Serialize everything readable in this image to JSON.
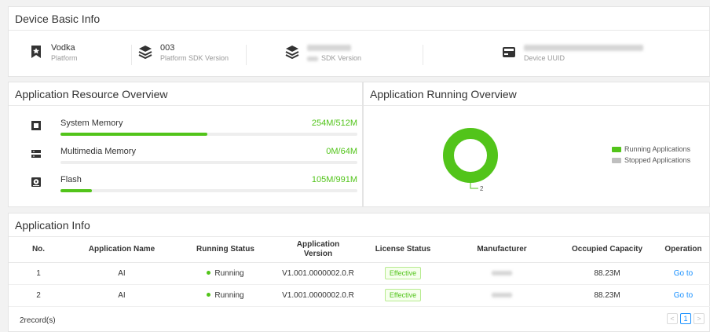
{
  "basic_info": {
    "title": "Device Basic Info",
    "items": [
      {
        "value": "Vodka",
        "label": "Platform",
        "icon": "bookmark-star-icon"
      },
      {
        "value": "003",
        "label": "Platform SDK Version",
        "icon": "layers-icon"
      },
      {
        "value": "",
        "label": "SDK Version",
        "icon": "layers-icon"
      },
      {
        "value": "",
        "label": "Device UUID",
        "icon": "device-card-icon"
      }
    ]
  },
  "resource": {
    "title": "Application Resource Overview",
    "items": [
      {
        "name": "System Memory",
        "value": "254M/512M",
        "fraction": 0.496,
        "icon": "memory-chip-icon"
      },
      {
        "name": "Multimedia Memory",
        "value": "0M/64M",
        "fraction": 0.0,
        "icon": "server-icon"
      },
      {
        "name": "Flash",
        "value": "105M/991M",
        "fraction": 0.106,
        "icon": "disk-icon"
      }
    ]
  },
  "running": {
    "title": "Application Running Overview",
    "running_count": 2,
    "stopped_count": 0,
    "callout_label": "2",
    "legend": [
      {
        "label": "Running Applications",
        "color": "#52c41a"
      },
      {
        "label": "Stopped Applications",
        "color": "#bfbfbf"
      }
    ]
  },
  "app_info": {
    "title": "Application Info",
    "columns": [
      "No.",
      "Application Name",
      "Running Status",
      "Application Version",
      "License Status",
      "Manufacturer",
      "Occupied Capacity",
      "Operation"
    ],
    "rows": [
      {
        "no": "1",
        "name": "AI",
        "status": "Running",
        "version": "V1.001.0000002.0.R",
        "license": "Effective",
        "manufacturer": "",
        "capacity": "88.23M",
        "operation": "Go to"
      },
      {
        "no": "2",
        "name": "AI",
        "status": "Running",
        "version": "V1.001.0000002.0.R",
        "license": "Effective",
        "manufacturer": "",
        "capacity": "88.23M",
        "operation": "Go to"
      }
    ],
    "record_count": "2record(s)",
    "pagination": {
      "prev": "<",
      "page": "1",
      "next": ">"
    }
  }
}
